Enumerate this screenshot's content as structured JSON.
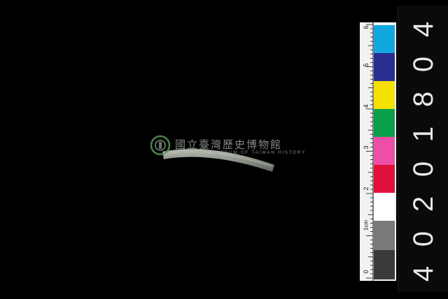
{
  "watermark": {
    "text_cn": "國立臺灣歷史博物館",
    "text_en": "NATIONAL MUSEUM OF TAIWAN HISTORY"
  },
  "ruler": {
    "unit_label": "1cm",
    "numbers": [
      "0",
      "2",
      "3",
      "4",
      "5",
      "6"
    ],
    "swatches": [
      "#3a3a3a",
      "#7a7a7a",
      "#ffffff",
      "#e0103a",
      "#ee4fa6",
      "#0aa04a",
      "#f4e100",
      "#2a2e8e",
      "#11a8e0"
    ]
  },
  "catalog_number": [
    "4",
    "0",
    "2",
    "0",
    "1",
    "8",
    "0",
    "4"
  ],
  "colors": {
    "background": "#000000",
    "artifact": "#8a9088"
  }
}
